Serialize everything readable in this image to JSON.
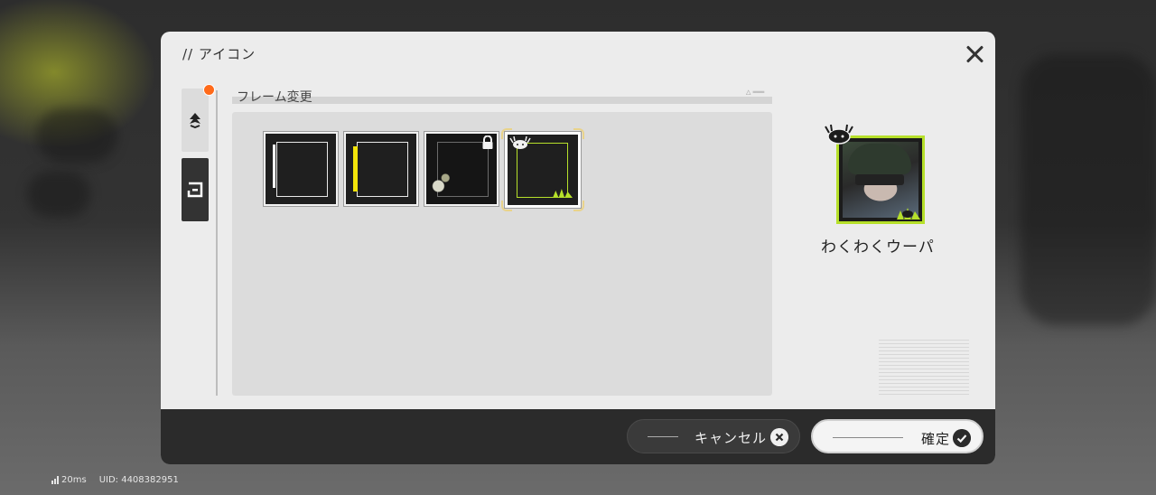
{
  "modal": {
    "title": "// アイコン",
    "close_label": "×"
  },
  "section": {
    "title": "フレーム変更"
  },
  "frames": [
    {
      "name": "frame-1",
      "locked": false,
      "selected": false
    },
    {
      "name": "frame-2",
      "locked": false,
      "selected": false
    },
    {
      "name": "frame-3",
      "locked": true,
      "selected": false
    },
    {
      "name": "frame-4",
      "locked": false,
      "selected": true
    }
  ],
  "preview": {
    "player_name": "わくわくウーパ"
  },
  "footer": {
    "cancel_label": "キャンセル",
    "confirm_label": "確定"
  },
  "status": {
    "ping": "20ms",
    "uid": "UID: 4408382951"
  },
  "colors": {
    "accent_green": "#b6e02a",
    "notification_dot": "#ff6a1a",
    "stripe_yellow": "#f3e40a"
  }
}
